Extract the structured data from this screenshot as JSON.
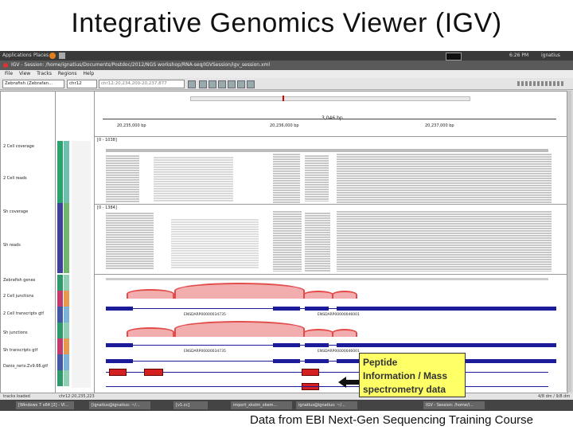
{
  "slide": {
    "title": "Integrative Genomics Viewer (IGV)",
    "footer": "Data from EBI Next-Gen Sequencing Training Course",
    "callout": [
      "Peptide",
      "Information / Mass",
      "spectrometry data"
    ]
  },
  "desktop": {
    "apps": "Applications",
    "places": "Places",
    "time": "6:26 PM",
    "user": "ignatius"
  },
  "window": {
    "title": "IGV - Session: /home/ignatius/Documents/Postdoc/2012/NGS workshop/RNA-seq/IGVSession/igv_session.xml"
  },
  "menu": [
    "File",
    "View",
    "Tracks",
    "Regions",
    "Help"
  ],
  "toolbar": {
    "genome": "Zebrafish (Zebrafan...",
    "chromosome": "chr12",
    "locus": "chr12:20,234,200-20,237,877"
  },
  "ruler": {
    "span": "3,046 bp",
    "ticks": [
      "20,235,000 bp",
      "20,236,000 bp",
      "20,237,000 bp"
    ],
    "range1": "[0 - 1038]",
    "range2": "[0 - 1384]"
  },
  "tracks": [
    "2 Cell coverage",
    "2 Cell reads",
    "Sh coverage",
    "Sh reads",
    "Zebrafish genes",
    "2 Cell junctions",
    "2 Cell transcripts gtf",
    "Sh junctions",
    "Sh transcripts gtf",
    "Danio_rerio.Zv9.66.gtf"
  ],
  "gene_labels": [
    "ENSDARP00000034735",
    "ENSDARP00000046001"
  ],
  "status": {
    "left": "tracks loaded",
    "mid": "chr12:20,235,223",
    "right": "4/8 dm / 9/8 dm"
  },
  "taskbar": [
    "[Windows 7 x64 [2] - VI...",
    "[ignatius@ignatius: ~/...",
    "[v1.cc]",
    "import_xkstm_xkem...",
    "ignatius@ignatius: ~/...",
    "IGV - Session: /home/i..."
  ],
  "colors": {
    "exon": "#1c1c9a",
    "peptide": "#d42020",
    "junction": "#e34b4b",
    "callout": "#ffff66"
  }
}
